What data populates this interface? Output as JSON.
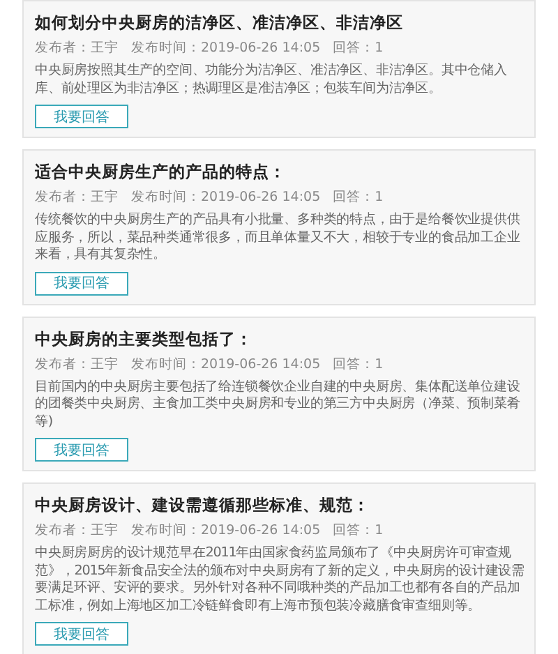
{
  "questions": [
    {
      "title": "如何划分中央厨房的洁净区、准洁净区、非洁净区",
      "author": "发布者：王宇",
      "time": "发布时间：2019-06-26 14:05",
      "answers": "回答：1",
      "body": "中央厨房按照其生产的空间、功能分为洁净区、准洁净区、非洁净区。其中仓储入库、前处理区为非洁净区；热调理区是准洁净区；包装车间为洁净区。",
      "button": "我要回答"
    },
    {
      "title": "适合中央厨房生产的产品的特点：",
      "author": "发布者：王宇",
      "time": "发布时间：2019-06-26 14:05",
      "answers": "回答：1",
      "body": "传统餐饮的中央厨房生产的产品具有小批量、多种类的特点，由于是给餐饮业提供供应服务，所以，菜品种类通常很多，而且单体量又不大，相较于专业的食品加工企业来看，具有其复杂性。",
      "button": "我要回答"
    },
    {
      "title": "中央厨房的主要类型包括了：",
      "author": "发布者：王宇",
      "time": "发布时间：2019-06-26 14:05",
      "answers": "回答：1",
      "body": "目前国内的中央厨房主要包括了给连锁餐饮企业自建的中央厨房、集体配送单位建设的团餐类中央厨房、主食加工类中央厨房和专业的第三方中央厨房（净菜、预制菜肴等)",
      "button": "我要回答"
    },
    {
      "title": "中央厨房设计、建设需遵循那些标准、规范：",
      "author": "发布者：王宇",
      "time": "发布时间：2019-06-26 14:05",
      "answers": "回答：1",
      "body": "中央厨房厨房的设计规范早在2011年由国家食药监局颁布了《中央厨房许可审查规范》，2015年新食品安全法的颁布对中央厨房有了新的定义，中央厨房的设计建设需要满足环评、安评的要求。另外针对各种不同哦种类的产品加工也都有各自的产品加工标准，例如上海地区加工冷链鲜食即有上海市预包装冷藏膳食审查细则等。",
      "button": "我要回答"
    }
  ]
}
